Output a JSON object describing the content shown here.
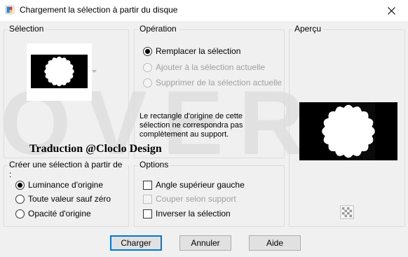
{
  "window": {
    "title": "Chargement la sélection à partir du disque",
    "icons": {
      "app": "paint-shop-pro-icon",
      "close": "close-icon"
    }
  },
  "watermark": {
    "text": "OVER"
  },
  "selection_group": {
    "label": "Sélection",
    "dropdown_icon": "chevron-down-icon"
  },
  "operation_group": {
    "label": "Opération",
    "options": [
      {
        "label": "Remplacer la sélection",
        "checked": true,
        "enabled": true
      },
      {
        "label": "Ajouter à la sélection actuelle",
        "checked": false,
        "enabled": false
      },
      {
        "label": "Supprimer de la sélection actuelle",
        "checked": false,
        "enabled": false
      }
    ],
    "warning": "Le rectangle d'origine de cette\nsélection ne correspondra pas\ncomplètement au support."
  },
  "preview_group": {
    "label": "Aperçu",
    "transparency_icon": "checkerboard-icon"
  },
  "credit": "Traduction @Cloclo Design",
  "source_group": {
    "label": "Créer une sélection à partir de :",
    "options": [
      {
        "label": "Luminance d'origine",
        "checked": true
      },
      {
        "label": "Toute valeur sauf zéro",
        "checked": false
      },
      {
        "label": "Opacité d'origine",
        "checked": false
      }
    ]
  },
  "options_group": {
    "label": "Options",
    "items": [
      {
        "label": "Angle supérieur gauche",
        "checked": false,
        "enabled": true
      },
      {
        "label": "Couper selon support",
        "checked": false,
        "enabled": false
      },
      {
        "label": "Inverser la sélection",
        "checked": false,
        "enabled": true
      }
    ]
  },
  "buttons": {
    "load": "Charger",
    "cancel": "Annuler",
    "help": "Aide"
  },
  "colors": {
    "dialog_bg": "#f0f0f0",
    "focus_border": "#0078d7",
    "disabled_text": "#a0a0a0"
  }
}
